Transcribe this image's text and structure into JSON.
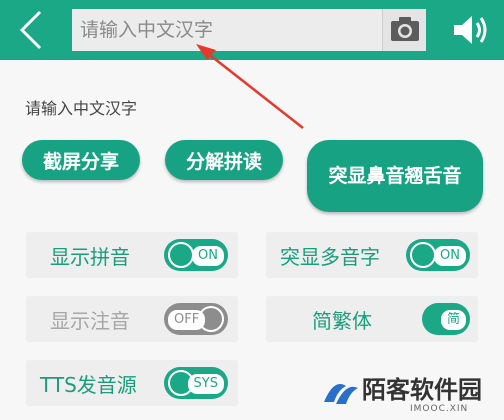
{
  "topbar": {
    "search_placeholder": "请输入中文汉字",
    "icons": {
      "back": "back-chevron-icon",
      "camera": "camera-icon",
      "sound": "speaker-icon"
    },
    "accent_color": "#1aa886"
  },
  "hint_text": "请输入中文汉字",
  "actions": {
    "share_label": "截屏分享",
    "split_label": "分解拼读",
    "nasal_label": "突显鼻音翘舌音"
  },
  "settings": [
    {
      "label": "显示拼音",
      "toggle": "ON",
      "state": "on"
    },
    {
      "label": "突显多音字",
      "toggle": "ON",
      "state": "on"
    },
    {
      "label": "显示注音",
      "toggle": "OFF",
      "state": "off"
    },
    {
      "label": "简繁体",
      "toggle": "简",
      "state": "on"
    },
    {
      "label": "TTS发音源",
      "toggle": "SYS",
      "state": "on"
    }
  ],
  "watermark": {
    "title": "陌客软件园",
    "subtitle": "IMOOC.XIN"
  }
}
